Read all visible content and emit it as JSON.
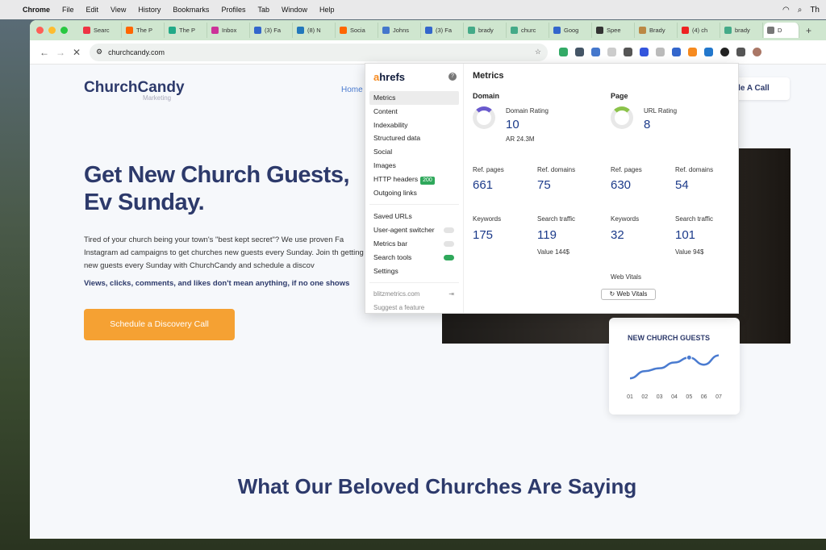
{
  "menubar": {
    "app": "Chrome",
    "items": [
      "File",
      "Edit",
      "View",
      "History",
      "Bookmarks",
      "Profiles",
      "Tab",
      "Window",
      "Help"
    ],
    "right_text": "Th"
  },
  "tabs": [
    {
      "label": "Searc",
      "color": "#e34"
    },
    {
      "label": "The P",
      "color": "#f60"
    },
    {
      "label": "The P",
      "color": "#2a8"
    },
    {
      "label": "Inbox",
      "color": "#c39"
    },
    {
      "label": "(3) Fa",
      "color": "#36c"
    },
    {
      "label": "(8) N",
      "color": "#27b"
    },
    {
      "label": "Socia",
      "color": "#f60"
    },
    {
      "label": "Johns",
      "color": "#47c"
    },
    {
      "label": "(3) Fa",
      "color": "#36c"
    },
    {
      "label": "brady",
      "color": "#4a8"
    },
    {
      "label": "churc",
      "color": "#4a8"
    },
    {
      "label": "Goog",
      "color": "#36c"
    },
    {
      "label": "Spee",
      "color": "#333"
    },
    {
      "label": "Brady",
      "color": "#b84"
    },
    {
      "label": "(4) ch",
      "color": "#e22"
    },
    {
      "label": "brady",
      "color": "#4a8"
    },
    {
      "label": "D",
      "color": "#777"
    }
  ],
  "url": "churchcandy.com",
  "site": {
    "logo": "ChurchCandy",
    "logo_sub": "Marketing",
    "nav_home": "Home",
    "top_button": "ule A Call",
    "hero_title": "Get New Church Guests, Ev Sunday.",
    "hero_body": "Tired of your church being your town's \"best kept secret\"? We use proven Fa Instagram ad campaigns to get churches new guests every Sunday. Join th getting new guests every Sunday with ChurchCandy and schedule a discov",
    "hero_bold": "Views, clicks, comments, and likes don't mean anything, if no one shows",
    "cta": "Schedule a Discovery Call",
    "guests_title": "NEW CHURCH GUESTS",
    "guests_chart": {
      "type": "line",
      "categories": [
        "01",
        "02",
        "03",
        "04",
        "05",
        "06",
        "07"
      ],
      "values": [
        1,
        2,
        2.4,
        3.2,
        3.9,
        2.9,
        4.2
      ]
    },
    "testimonials": "What Our Beloved Churches Are Saying"
  },
  "ahrefs": {
    "brand_a": "a",
    "brand_rest": "hrefs",
    "menu": [
      "Metrics",
      "Content",
      "Indexability",
      "Structured data",
      "Social",
      "Images",
      "HTTP headers",
      "Outgoing links"
    ],
    "http_badge": "200",
    "menu2": [
      "Saved URLs",
      "User-agent switcher",
      "Metrics bar",
      "Search tools",
      "Settings"
    ],
    "footer_link": "blitzmetrics.com",
    "suggest": "Suggest a feature",
    "title": "Metrics",
    "domain": {
      "heading": "Domain",
      "rating_label": "Domain Rating",
      "rating": "10",
      "ar": "AR 24.3M",
      "ref_pages_label": "Ref. pages",
      "ref_pages": "661",
      "ref_domains_label": "Ref. domains",
      "ref_domains": "75",
      "keywords_label": "Keywords",
      "keywords": "175",
      "traffic_label": "Search traffic",
      "traffic": "119",
      "value": "Value 144$"
    },
    "page": {
      "heading": "Page",
      "rating_label": "URL Rating",
      "rating": "8",
      "ref_pages_label": "Ref. pages",
      "ref_pages": "630",
      "ref_domains_label": "Ref. domains",
      "ref_domains": "54",
      "keywords_label": "Keywords",
      "keywords": "32",
      "traffic_label": "Search traffic",
      "traffic": "101",
      "value": "Value 94$",
      "web_vitals_label": "Web Vitals",
      "web_vitals_btn": "Web Vitals"
    }
  }
}
